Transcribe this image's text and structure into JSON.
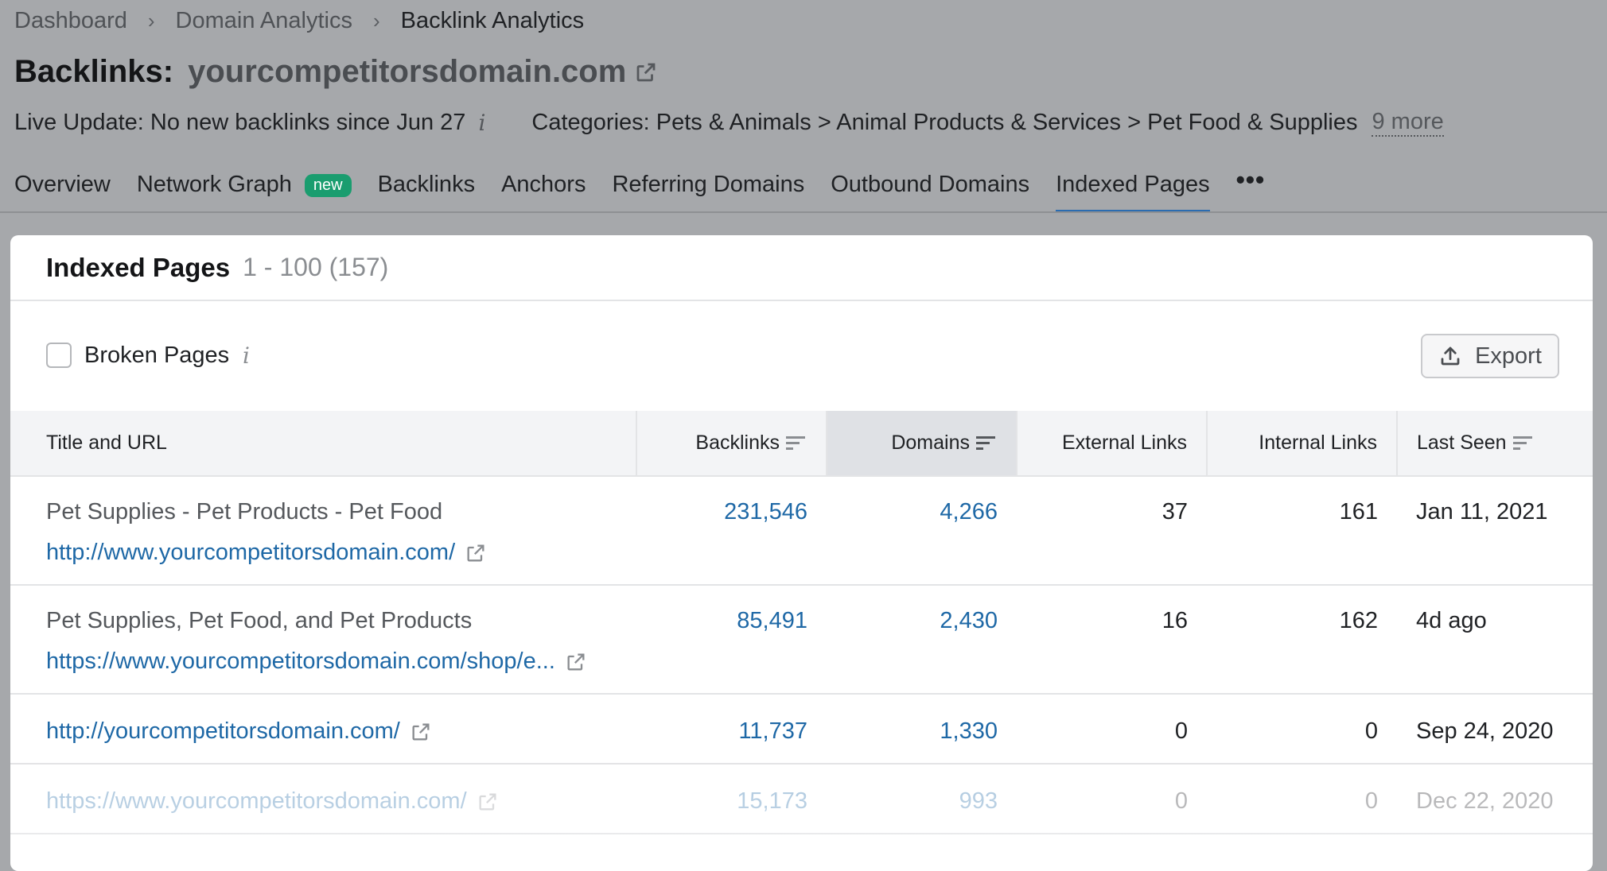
{
  "breadcrumb": [
    "Dashboard",
    "Domain Analytics",
    "Backlink Analytics"
  ],
  "header": {
    "label": "Backlinks:",
    "domain": "yourcompetitorsdomain.com",
    "live_update": "Live Update: No new backlinks since Jun 27",
    "info_glyph": "i",
    "categories": "Categories: Pets & Animals > Animal Products & Services > Pet Food & Supplies",
    "more_link": "9 more"
  },
  "tabs": [
    {
      "label": "Overview",
      "active": false
    },
    {
      "label": "Network Graph",
      "badge": "new",
      "active": false
    },
    {
      "label": "Backlinks",
      "active": false
    },
    {
      "label": "Anchors",
      "active": false
    },
    {
      "label": "Referring Domains",
      "active": false
    },
    {
      "label": "Outbound Domains",
      "active": false
    },
    {
      "label": "Indexed Pages",
      "active": true
    }
  ],
  "tabs_more": "•••",
  "card": {
    "title": "Indexed Pages",
    "range": "1 - 100 (157)",
    "filter_label": "Broken Pages",
    "filter_checked": false,
    "export_label": "Export"
  },
  "table": {
    "columns": [
      "Title and URL",
      "Backlinks",
      "Domains",
      "External Links",
      "Internal Links",
      "Last Seen"
    ],
    "rows": [
      {
        "title": "Pet Supplies - Pet Products - Pet Food",
        "url": "http://www.yourcompetitorsdomain.com/",
        "backlinks": "231,546",
        "domains": "4,266",
        "external": "37",
        "internal": "161",
        "last_seen": "Jan 11, 2021"
      },
      {
        "title": "Pet Supplies, Pet Food, and Pet Products",
        "url": "https://www.yourcompetitorsdomain.com/shop/e...",
        "backlinks": "85,491",
        "domains": "2,430",
        "external": "16",
        "internal": "162",
        "last_seen": "4d ago"
      },
      {
        "title": "",
        "url": "http://yourcompetitorsdomain.com/",
        "backlinks": "11,737",
        "domains": "1,330",
        "external": "0",
        "internal": "0",
        "last_seen": "Sep 24, 2020"
      },
      {
        "title": "",
        "url": "https://www.yourcompetitorsdomain.com/",
        "backlinks": "15,173",
        "domains": "993",
        "external": "0",
        "internal": "0",
        "last_seen": "Dec 22, 2020"
      }
    ]
  }
}
